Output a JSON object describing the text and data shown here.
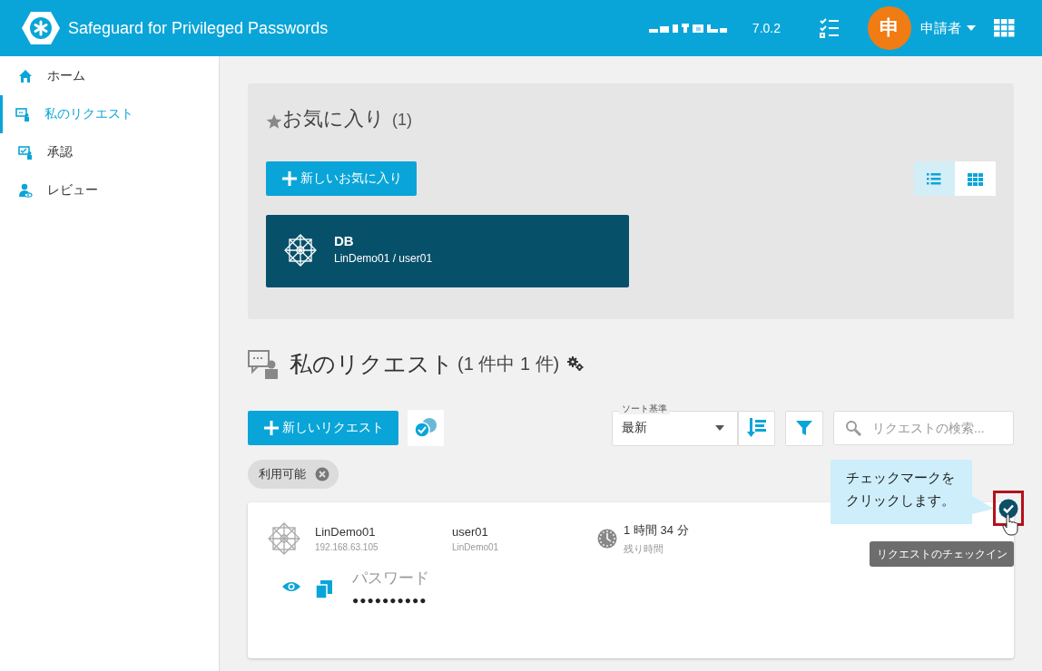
{
  "header": {
    "title": "Safeguard for Privileged Passwords",
    "version": "7.0.2",
    "user": {
      "initial": "申",
      "name": "申請者"
    }
  },
  "sidebar": {
    "items": [
      {
        "label": "ホーム",
        "kind": "home",
        "selected": false
      },
      {
        "label": "私のリクエスト",
        "kind": "request",
        "selected": true
      },
      {
        "label": "承認",
        "kind": "approve",
        "selected": false
      },
      {
        "label": "レビュー",
        "kind": "review",
        "selected": false
      }
    ]
  },
  "favorites": {
    "title": "お気に入り",
    "count": "(1)",
    "new_button": "新しいお気に入り",
    "views": [
      {
        "kind": "list",
        "selected": true
      },
      {
        "kind": "grid",
        "selected": false
      }
    ],
    "items": [
      {
        "name": "DB",
        "detail": "LinDemo01 / user01"
      }
    ]
  },
  "requests": {
    "title": "私のリクエスト",
    "count": "(1 件中 1 件)",
    "new_button": "新しいリクエスト",
    "sort": {
      "label": "ソート基準",
      "value": "最新"
    },
    "search": {
      "placeholder": "リクエストの検索..."
    },
    "filters": [
      {
        "label": "利用可能"
      }
    ],
    "items": [
      {
        "asset": "LinDemo01",
        "address": "192.168.63.105",
        "account": "user01",
        "account_asset": "LinDemo01",
        "time": "1 時間 34 分",
        "time_label": "残り時間",
        "credential_label": "パスワード",
        "credential_value": "●●●●●●●●●●"
      }
    ]
  },
  "annotation": {
    "callout_lines": [
      "チェックマークを",
      "クリックします。"
    ],
    "tooltip": "リクエストのチェックイン"
  }
}
